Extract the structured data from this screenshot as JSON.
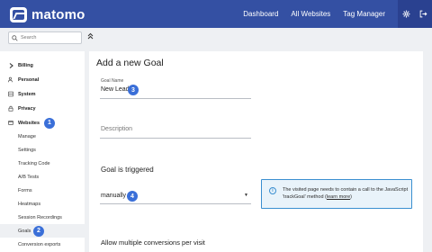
{
  "header": {
    "logo_text": "matomo",
    "nav": [
      "Dashboard",
      "All Websites",
      "Tag Manager"
    ],
    "icons": [
      "gear-icon",
      "sign-out-icon"
    ]
  },
  "search": {
    "placeholder": "Search"
  },
  "sidebar": {
    "items": [
      {
        "label": "Billing",
        "icon": "chevron-right-icon",
        "level": "top"
      },
      {
        "label": "Personal",
        "icon": "person-icon",
        "level": "top"
      },
      {
        "label": "System",
        "icon": "server-icon",
        "level": "top"
      },
      {
        "label": "Privacy",
        "icon": "lock-icon",
        "level": "top"
      },
      {
        "label": "Websites",
        "icon": "globe-icon",
        "level": "top",
        "badge": "1"
      },
      {
        "label": "Manage",
        "level": "sub"
      },
      {
        "label": "Settings",
        "level": "sub"
      },
      {
        "label": "Tracking Code",
        "level": "sub"
      },
      {
        "label": "A/B Tests",
        "level": "sub"
      },
      {
        "label": "Forms",
        "level": "sub"
      },
      {
        "label": "Heatmaps",
        "level": "sub"
      },
      {
        "label": "Session Recordings",
        "level": "sub"
      },
      {
        "label": "Goals",
        "level": "sub",
        "badge": "2",
        "active": true
      },
      {
        "label": "Conversion exports",
        "level": "sub"
      }
    ]
  },
  "main": {
    "title": "Add a new Goal",
    "goal_name_label": "Goal Name",
    "goal_name_value": "New Lead",
    "goal_name_badge": "3",
    "description_placeholder": "Description",
    "triggered_heading": "Goal is triggered",
    "triggered_value": "manually",
    "triggered_badge": "4",
    "info_text": "The visited page needs to contain a call to the JavaScript 'trackGoal' method (",
    "info_link": "learn more",
    "info_text_end": ")",
    "allow_multiple": "Allow multiple conversions per visit"
  },
  "colors": {
    "header": "#3450a3",
    "badge": "#3a6fd8",
    "info_border": "#3a8fd0",
    "info_bg": "#e9f3fa"
  }
}
